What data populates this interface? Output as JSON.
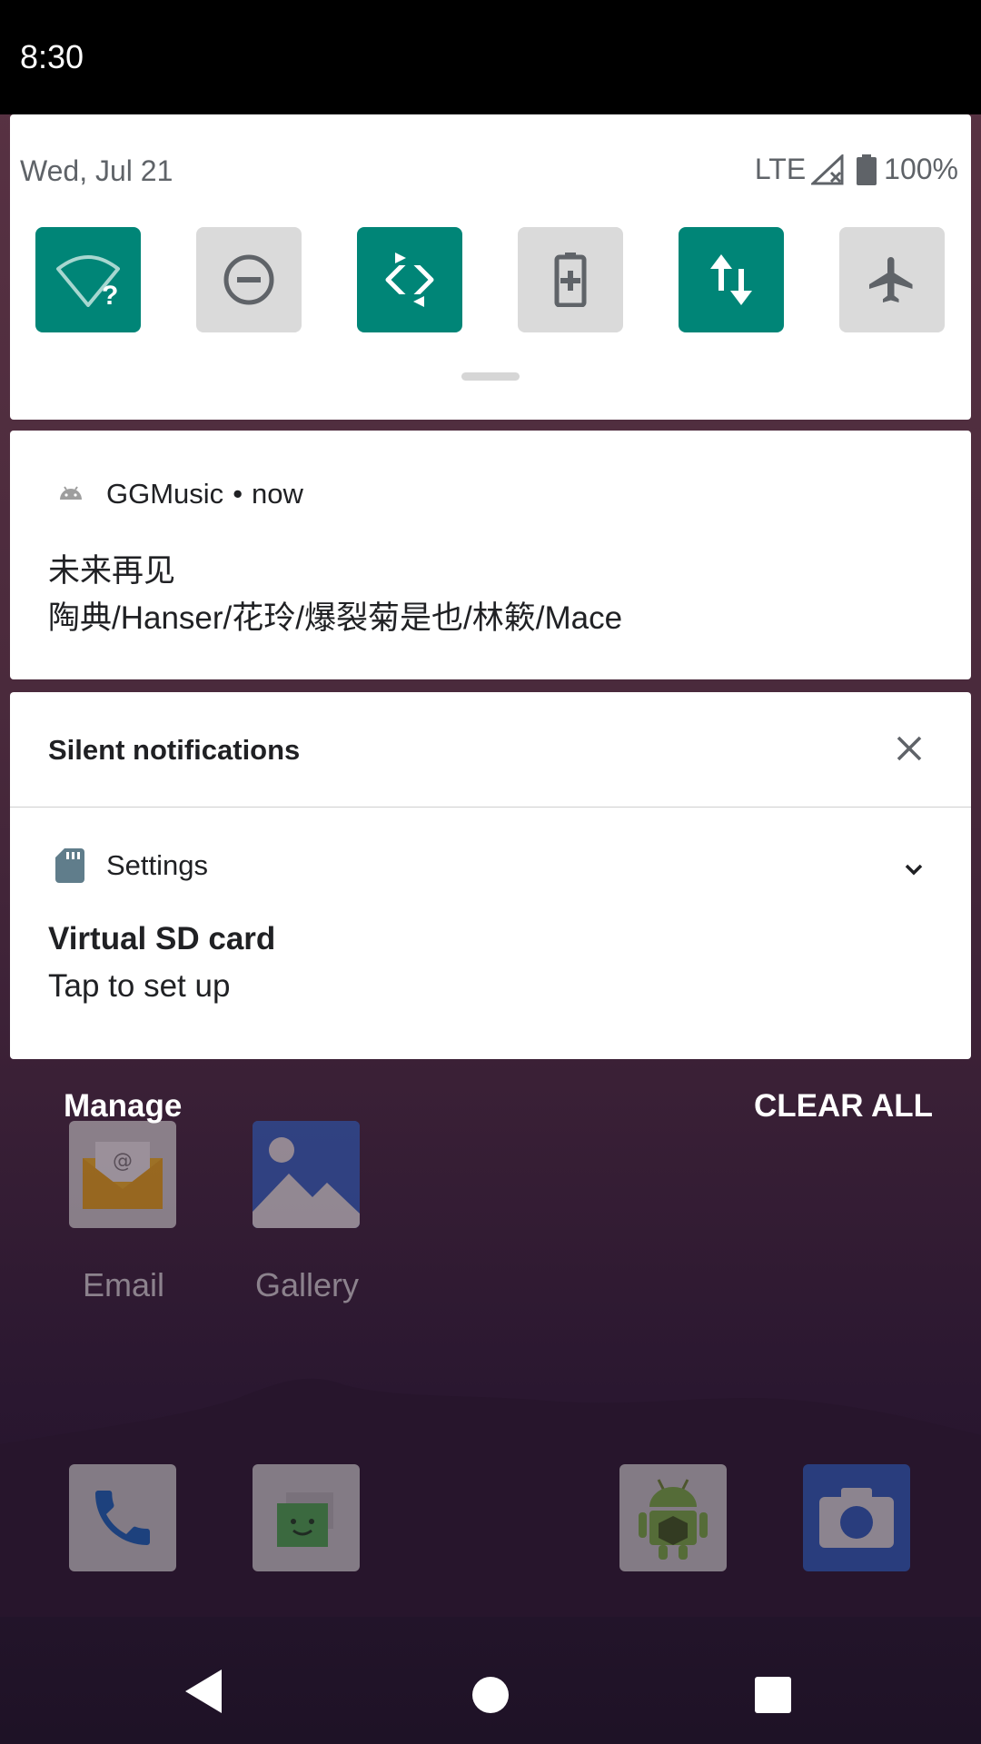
{
  "status_bar": {
    "time": "8:30"
  },
  "quick_settings": {
    "date": "Wed, Jul 21",
    "network": "LTE",
    "battery": "100%",
    "tiles": [
      {
        "name": "wifi-tile",
        "icon": "wifi-unknown-icon",
        "state": "on"
      },
      {
        "name": "do-not-disturb-tile",
        "icon": "do-not-disturb-icon",
        "state": "off"
      },
      {
        "name": "auto-rotate-tile",
        "icon": "auto-rotate-icon",
        "state": "on"
      },
      {
        "name": "battery-saver-tile",
        "icon": "battery-saver-icon",
        "state": "off"
      },
      {
        "name": "mobile-data-tile",
        "icon": "mobile-data-icon",
        "state": "on"
      },
      {
        "name": "airplane-mode-tile",
        "icon": "airplane-icon",
        "state": "off"
      }
    ],
    "accent_color": "#008577"
  },
  "music_notification": {
    "app_name": "GGMusic",
    "time_label": "now",
    "title": "未来再见",
    "text": "陶典/Hanser/花玲/爆裂菊是也/林簌/Mace"
  },
  "silent_section": {
    "header": "Silent notifications",
    "notification": {
      "app_name": "Settings",
      "title": "Virtual SD card",
      "text": "Tap to set up"
    }
  },
  "footer": {
    "manage_label": "Manage",
    "clear_all_label": "CLEAR ALL"
  },
  "home_screen": {
    "apps": [
      {
        "label": "Email",
        "icon": "email-icon"
      },
      {
        "label": "Gallery",
        "icon": "gallery-icon"
      }
    ],
    "dock": [
      "phone-icon",
      "messages-icon",
      "android-app-icon",
      "camera-icon"
    ]
  }
}
